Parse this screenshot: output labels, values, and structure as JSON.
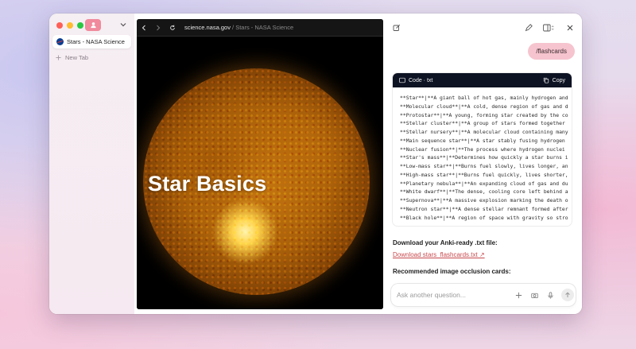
{
  "window": {
    "traffic_colors": [
      "#fe5f57",
      "#febc2e",
      "#28c840"
    ],
    "accent": "#f08a9c"
  },
  "sidebar": {
    "profile_icon": "person-icon",
    "tabs": [
      {
        "label": "Stars - NASA Science",
        "icon": "nasa-logo-icon",
        "active": true
      }
    ],
    "new_tab_label": "New Tab"
  },
  "browser": {
    "url_domain": "science.nasa.gov",
    "url_path": " / Stars - NASA Science"
  },
  "page": {
    "hero_title": "Star Basics"
  },
  "assistant": {
    "user_message": "/flashcards",
    "code_block": {
      "lang_label": "Code · txt",
      "copy_label": "Copy",
      "lines": [
        "**Star**|**A giant ball of hot gas, mainly hydrogen and",
        "**Molecular cloud**|**A cold, dense region of gas and d",
        "**Protostar**|**A young, forming star created by the co",
        "**Stellar cluster**|**A group of stars formed together",
        "**Stellar nursery**|**A molecular cloud containing many",
        "**Main sequence star**|**A star stably fusing hydrogen",
        "**Nuclear fusion**|**The process where hydrogen nuclei",
        "**Star's mass**|**Determines how quickly a star burns i",
        "**Low-mass star**|**Burns fuel slowly, lives longer, an",
        "**High-mass star**|**Burns fuel quickly, lives shorter,",
        "**Planetary nebula**|**An expanding cloud of gas and du",
        "**White dwarf**|**The dense, cooling core left behind a",
        "**Supernova**|**A massive explosion marking the death o",
        "**Neutron star**|**A dense stellar remnant formed after",
        "**Black hole**|**A region of space with gravity so stro"
      ]
    },
    "download_heading": "Download your Anki-ready .txt file:",
    "download_link": "Download stars_flashcards.txt ↗",
    "recommend_heading": "Recommended image occlusion cards:",
    "composer_placeholder": "Ask another question..."
  }
}
